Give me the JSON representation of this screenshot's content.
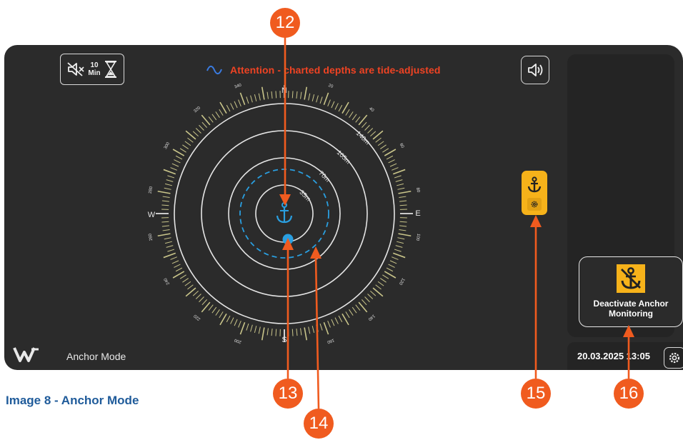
{
  "toolbar": {
    "mute_minutes_number": "10",
    "mute_minutes_unit": "Min"
  },
  "banner": {
    "text": "Attention - charted depths are tide-adjusted",
    "color": "#ef4323",
    "icon": "tide-wave-icon"
  },
  "compass": {
    "cardinals": {
      "n": "N",
      "e": "E",
      "s": "S",
      "w": "W"
    },
    "degree_labels": [
      "20",
      "40",
      "60",
      "80",
      "100",
      "120",
      "140",
      "160",
      "180",
      "200",
      "220",
      "240",
      "260",
      "280",
      "300",
      "320",
      "340"
    ],
    "ranges": [
      "35m",
      "70m",
      "105m",
      "140m"
    ],
    "alarm_radius_color": "#2a9fe0",
    "boat_color": "#2a9fe0",
    "tick_color": "#c9c58a"
  },
  "side": {
    "anchor_toggle_icon": "anchor-icon",
    "anchor_toggle_sub_icon": "gear-icon",
    "deactivate_label_line1": "Deactivate Anchor",
    "deactivate_label_line2": "Monitoring",
    "accent": "#f6b21a"
  },
  "footer": {
    "mode_label": "Anchor Mode",
    "datetime": "20.03.2025 13:05"
  },
  "caption": "Image 8 - Anchor Mode",
  "callouts": [
    "12",
    "13",
    "14",
    "15",
    "16"
  ]
}
